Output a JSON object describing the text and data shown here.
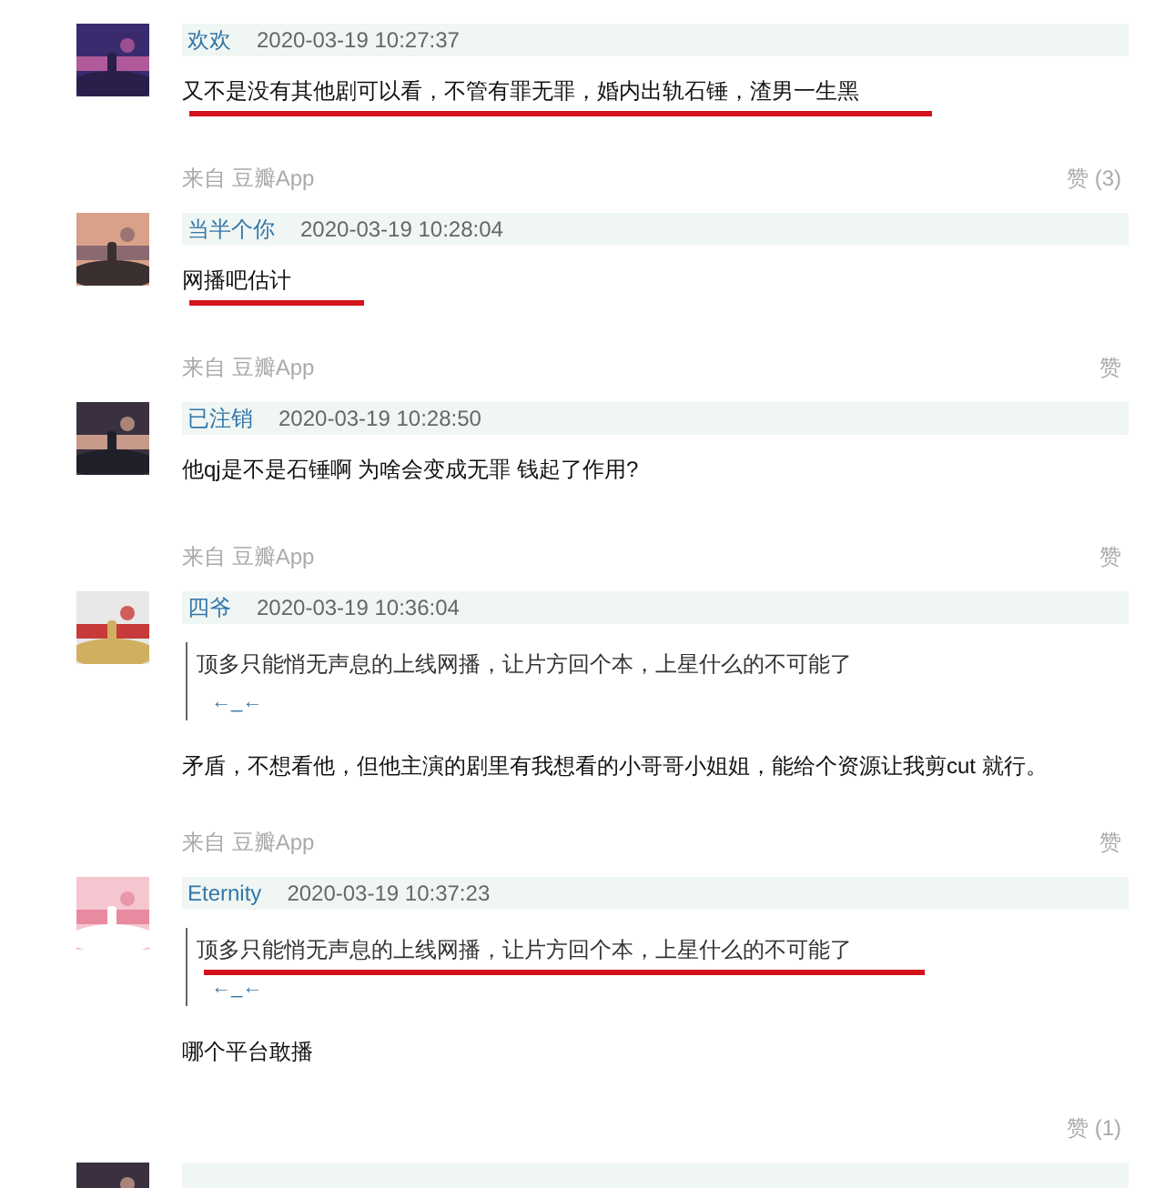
{
  "comments": [
    {
      "user": "欢欢",
      "time": "2020-03-19 10:27:37",
      "body": "又不是没有其他剧可以看，不管有罪无罪，婚内出轨石锤，渣男一生黑",
      "body_underlined": true,
      "source": "来自 豆瓣App",
      "likes": "赞 (3)"
    },
    {
      "user": "当半个你",
      "time": "2020-03-19 10:28:04",
      "body": "网播吧估计",
      "body_underlined": true,
      "source": "来自 豆瓣App",
      "likes": "赞"
    },
    {
      "user": "已注销",
      "time": "2020-03-19 10:28:50",
      "body": "他qj是不是石锤啊 为啥会变成无罪 钱起了作用?",
      "body_underlined": false,
      "source": "来自 豆瓣App",
      "likes": "赞"
    },
    {
      "user": "四爷",
      "time": "2020-03-19 10:36:04",
      "quote": {
        "text": "顶多只能悄无声息的上线网播，让片方回个本，上星什么的不可能了",
        "reply": "←_←",
        "underlined": false
      },
      "body": "矛盾，不想看他，但他主演的剧里有我想看的小哥哥小姐姐，能给个资源让我剪cut 就行。",
      "body_underlined": false,
      "source": "来自 豆瓣App",
      "likes": "赞"
    },
    {
      "user": "Eternity",
      "time": "2020-03-19 10:37:23",
      "quote": {
        "text": "顶多只能悄无声息的上线网播，让片方回个本，上星什么的不可能了",
        "reply": "←_←",
        "underlined": true
      },
      "body": "哪个平台敢播",
      "body_underlined": false,
      "likes": "赞 (1)"
    }
  ]
}
